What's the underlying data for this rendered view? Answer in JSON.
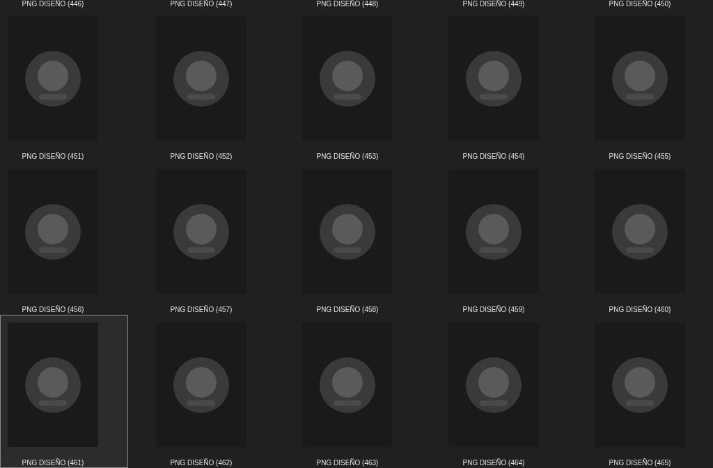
{
  "files": [
    {
      "kind": "label_only",
      "label": "PNG DISEÑO (446)",
      "selected": false
    },
    {
      "kind": "label_only",
      "label": "PNG DISEÑO (447)",
      "selected": false
    },
    {
      "kind": "label_only",
      "label": "PNG DISEÑO (448)",
      "selected": false
    },
    {
      "kind": "label_only",
      "label": "PNG DISEÑO (449)",
      "selected": false
    },
    {
      "kind": "label_only",
      "label": "PNG DISEÑO (450)",
      "selected": false
    },
    {
      "kind": "thumbnail",
      "label": "PNG DISEÑO (451)",
      "selected": false
    },
    {
      "kind": "thumbnail",
      "label": "PNG DISEÑO (452)",
      "selected": false
    },
    {
      "kind": "thumbnail",
      "label": "PNG DISEÑO (453)",
      "selected": false
    },
    {
      "kind": "thumbnail",
      "label": "PNG DISEÑO (454)",
      "selected": false
    },
    {
      "kind": "thumbnail",
      "label": "PNG DISEÑO (455)",
      "selected": false
    },
    {
      "kind": "thumbnail",
      "label": "PNG DISEÑO (456)",
      "selected": false
    },
    {
      "kind": "thumbnail",
      "label": "PNG DISEÑO (457)",
      "selected": false
    },
    {
      "kind": "thumbnail",
      "label": "PNG DISEÑO (458)",
      "selected": false
    },
    {
      "kind": "thumbnail",
      "label": "PNG DISEÑO (459)",
      "selected": false
    },
    {
      "kind": "thumbnail",
      "label": "PNG DISEÑO (460)",
      "selected": false
    },
    {
      "kind": "thumbnail",
      "label": "PNG DISEÑO (461)",
      "selected": true
    },
    {
      "kind": "thumbnail",
      "label": "PNG DISEÑO (462)",
      "selected": false
    },
    {
      "kind": "thumbnail",
      "label": "PNG DISEÑO (463)",
      "selected": false
    },
    {
      "kind": "thumbnail",
      "label": "PNG DISEÑO (464)",
      "selected": false
    },
    {
      "kind": "thumbnail",
      "label": "PNG DISEÑO (465)",
      "selected": false
    }
  ]
}
